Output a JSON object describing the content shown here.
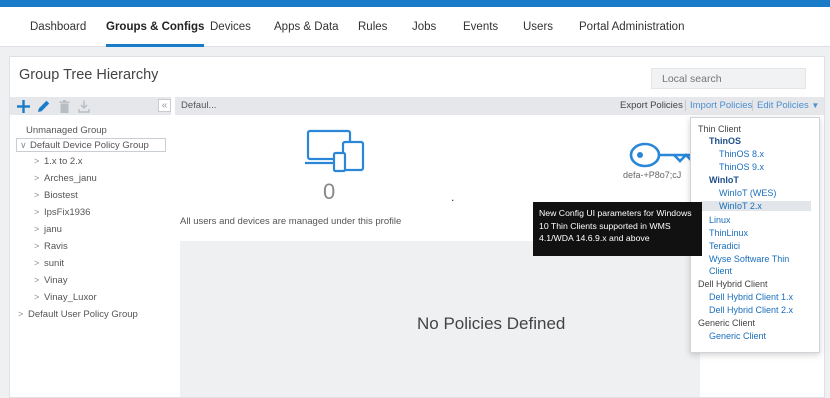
{
  "nav": {
    "items": [
      "Dashboard",
      "Groups & Configs",
      "Devices",
      "Apps & Data",
      "Rules",
      "Jobs",
      "Events",
      "Users",
      "Portal Administration"
    ],
    "active": "Groups & Configs"
  },
  "panel": {
    "title": "Group Tree Hierarchy",
    "search_placeholder": "Local search"
  },
  "toolbar": {
    "breadcrumb": "Defaul...",
    "export_label": "Export Policies",
    "import_label": "Import Policies",
    "edit_label": "Edit Policies",
    "add_icon": "plus-icon",
    "edit_icon": "pencil-icon",
    "delete_icon": "trash-icon",
    "download_icon": "download-icon",
    "collapse_glyph": "«"
  },
  "tree": {
    "unmanaged": "Unmanaged Group",
    "default_device": "Default Device Policy Group",
    "children": [
      "1.x to 2.x",
      "Arches_janu",
      "Biostest",
      "IpsFix1936",
      "janu",
      "Ravis",
      "sunit",
      "Vinay",
      "Vinay_Luxor"
    ],
    "default_user": "Default User Policy Group"
  },
  "main": {
    "device_count": "0",
    "dot": ".",
    "profile_text": "All users and devices are managed under this profile",
    "no_policies": "No Policies Defined",
    "key_caption": "defa-+P8o7;cJ"
  },
  "tooltip": {
    "lines": [
      "New Config UI parameters for Windows",
      "10 Thin Clients supported in WMS",
      "4.1/WDA 14.6.9.x and above"
    ]
  },
  "dropdown": {
    "thin_client": "Thin Client",
    "thinos": "ThinOS",
    "thinos_8x": "ThinOS 8.x",
    "thinos_9x": "ThinOS 9.x",
    "winiot": "WinIoT",
    "winiot_wes": "WinIoT (WES)",
    "winiot_2x": "WinIoT 2.x",
    "linux": "Linux",
    "thinlinux": "ThinLinux",
    "teradici": "Teradici",
    "wyse_line1": "Wyse Software Thin",
    "wyse_line2": "Client",
    "hybrid": "Dell Hybrid Client",
    "hybrid_1x": "Dell Hybrid Client 1.x",
    "hybrid_2x": "Dell Hybrid Client 2.x",
    "generic": "Generic Client",
    "generic_item": "Generic Client"
  },
  "colors": {
    "accent": "#1a7bc8",
    "tooltip_bg": "#111111"
  }
}
